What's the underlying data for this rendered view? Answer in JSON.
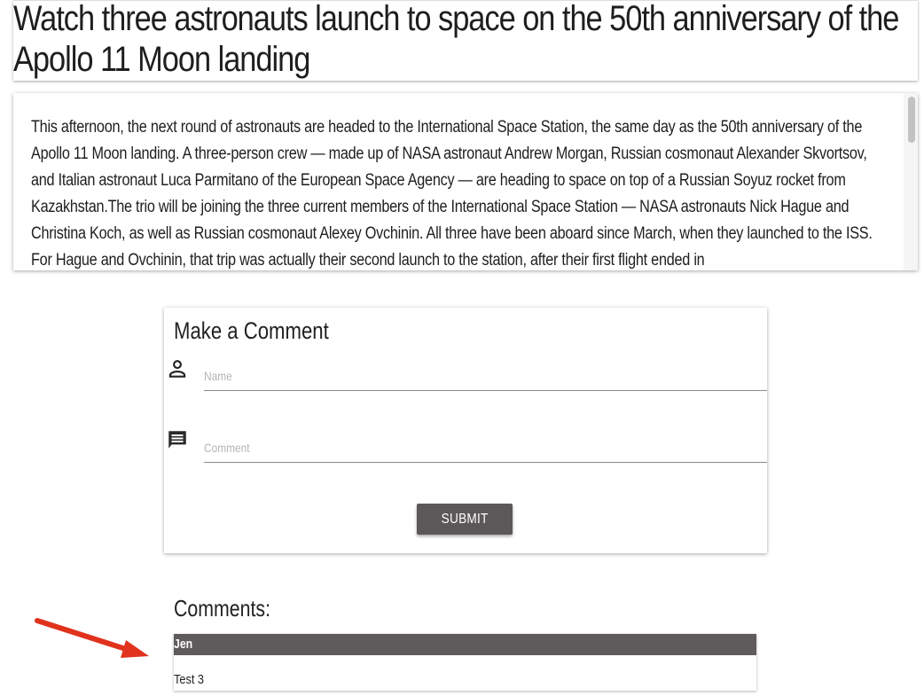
{
  "article": {
    "title": "Watch three astronauts launch to space on the 50th anniversary of the Apollo 11 Moon landing",
    "body": "This afternoon, the next round of astronauts are headed to the International Space Station, the same day as the 50th anniversary of the Apollo 11 Moon landing. A three-person crew — made up of NASA astronaut Andrew Morgan, Russian cosmonaut Alexander Skvortsov, and Italian astronaut Luca Parmitano of the European Space Agency — are heading to space on top of a Russian Soyuz rocket from Kazakhstan.The trio will be joining the three current members of the International Space Station — NASA astronauts Nick Hague and Christina Koch, as well as Russian cosmonaut Alexey Ovchinin. All three have been aboard since March, when they launched to the ISS. For Hague and Ovchinin, that trip was actually their second launch to the station, after their first flight ended in"
  },
  "comment_form": {
    "title": "Make a Comment",
    "name_placeholder": "Name",
    "name_value": "",
    "comment_placeholder": "Comment",
    "comment_value": "",
    "submit_label": "SUBMIT",
    "name_icon": "person-icon",
    "comment_icon": "comment-icon"
  },
  "comments": {
    "heading": "Comments:",
    "items": [
      {
        "author": "Jen",
        "text": "Test 3"
      }
    ]
  },
  "colors": {
    "button_bg": "#5c5758",
    "comment_author_bg": "#5f5a5b",
    "annotation_arrow": "#e0321c"
  }
}
